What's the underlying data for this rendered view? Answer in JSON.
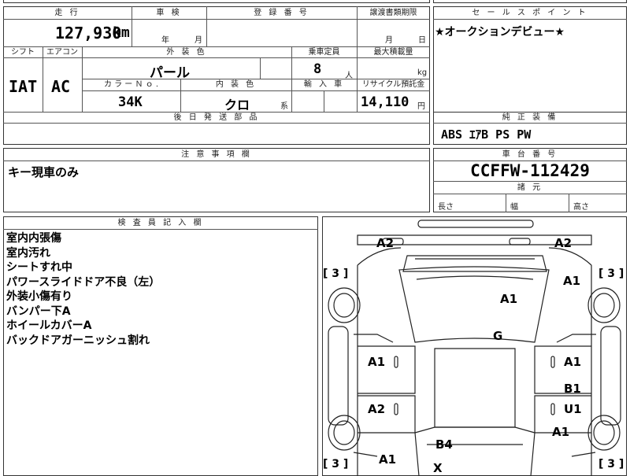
{
  "header": {
    "mileage_label": "走 行",
    "shaken_label": "車 検",
    "reg_label": "登 録 番 号",
    "transfer_label": "譲渡書類期限",
    "sale_label": "セ ー ル ス ポ イ ン ト"
  },
  "mileage": {
    "value": "127,930",
    "unit": "km"
  },
  "shaken": {
    "year": "年",
    "month": "月"
  },
  "transfer": {
    "month": "月",
    "day": "日"
  },
  "sale_point": "★オークションデビュー★",
  "row2": {
    "shift_label": "シフト",
    "ac_label": "エアコン",
    "ext_color_label": "外 装 色",
    "capacity_label": "乗車定員",
    "load_label": "最大積載量",
    "shift": "IAT",
    "ac": "AC",
    "ext_color": "パール",
    "capacity": "8",
    "capacity_unit": "人",
    "load_unit": "kg",
    "color_no_label": "カ ラ ー Ｎ ｏ .",
    "int_color_label": "内 装 色",
    "import_label": "輸 入 車",
    "recycle_label": "リサイクル預託金",
    "color_no": "34K",
    "int_color": "クロ",
    "int_suffix": "系",
    "recycle": "14,110",
    "recycle_unit": "円"
  },
  "later_parts_label": "後 日 発 送 部 品",
  "equipment": {
    "label": "純 正 装 備",
    "value": "ABS ｴｱB PS PW"
  },
  "caution": {
    "label": "注 意 事 項 欄",
    "value": "キー現車のみ"
  },
  "chassis": {
    "label": "車 台 番 号",
    "value": "CCFFW-112429"
  },
  "dimensions": {
    "label": "諸 元",
    "length": "長さ",
    "width": "幅",
    "height": "高さ"
  },
  "inspector": {
    "label": "検 査 員 記 入 欄",
    "notes": [
      "室内内張傷",
      "室内汚れ",
      "シートすれ中",
      "パワースライドドア不良（左）",
      "外装小傷有り",
      "バンパー下A",
      "ホイールカバーA",
      "バックドアガーニッシュ割れ"
    ]
  },
  "diagram": {
    "grades": {
      "front_left": "A2",
      "front_right": "A2",
      "right_fender": "A1",
      "hood": "A1",
      "roof": "G",
      "left_front_door": "A1",
      "right_front_door": "A1",
      "right_rear_b": "B1",
      "right_rear_u": "U1",
      "left_rear_door": "A2",
      "right_quarter": "A1",
      "back_door": "B4",
      "left_quarter": "A1",
      "rear_x": "X"
    },
    "tires": {
      "front_left": "3",
      "front_right": "3",
      "rear_left": "3",
      "rear_right": "3"
    }
  }
}
